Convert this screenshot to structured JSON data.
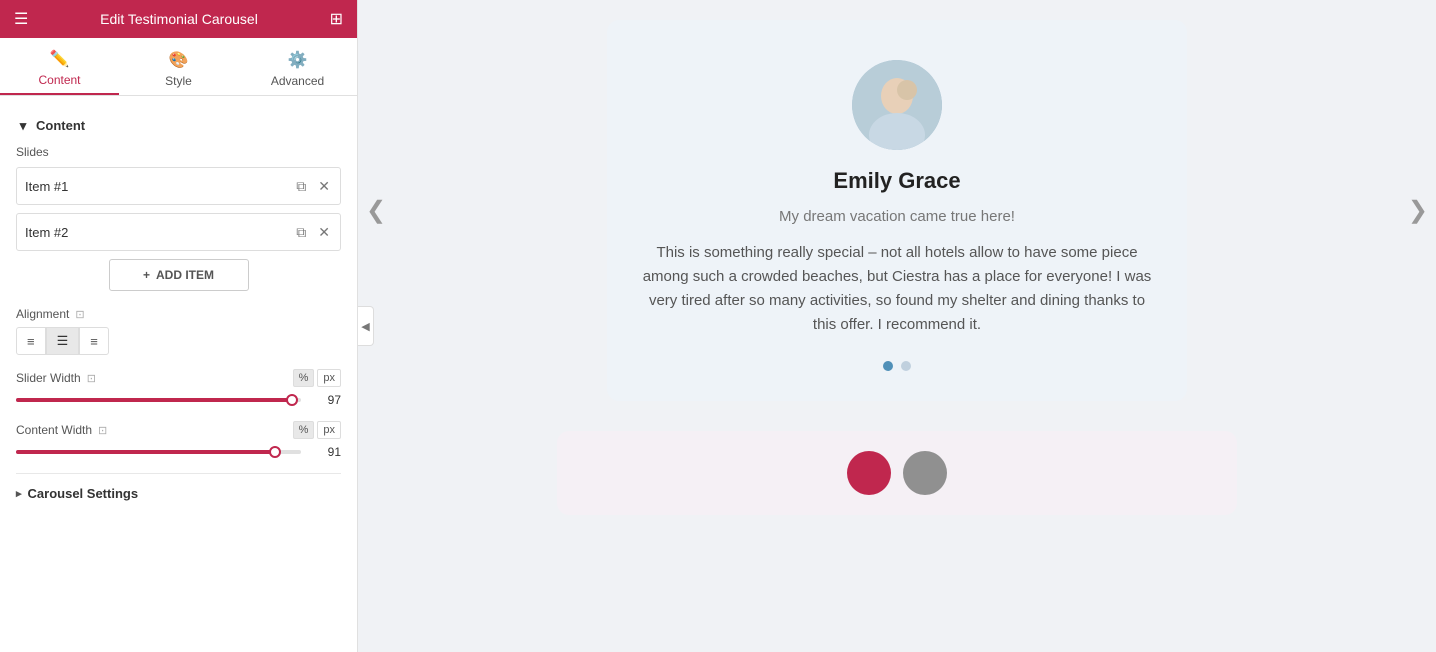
{
  "header": {
    "title": "Edit Testimonial Carousel",
    "menu_icon": "≡",
    "grid_icon": "⊞"
  },
  "tabs": [
    {
      "id": "content",
      "label": "Content",
      "icon": "✏️",
      "active": true
    },
    {
      "id": "style",
      "label": "Style",
      "icon": "🎨",
      "active": false
    },
    {
      "id": "advanced",
      "label": "Advanced",
      "icon": "⚙️",
      "active": false
    }
  ],
  "content_section": {
    "label": "Content",
    "slides_label": "Slides",
    "slides": [
      {
        "id": "item1",
        "label": "Item #1"
      },
      {
        "id": "item2",
        "label": "Item #2"
      }
    ],
    "add_item_label": "ADD ITEM",
    "alignment_label": "Alignment",
    "alignment_options": [
      "left",
      "center",
      "right"
    ],
    "active_alignment": "center",
    "slider_width_label": "Slider Width",
    "slider_width_value": "97",
    "slider_width_unit": "%",
    "slider_width_alt_unit": "px",
    "content_width_label": "Content Width",
    "content_width_value": "91",
    "content_width_unit": "%",
    "content_width_alt_unit": "px"
  },
  "carousel_settings": {
    "label": "Carousel Settings"
  },
  "testimonial": {
    "name": "Emily Grace",
    "subtitle": "My dream vacation came true here!",
    "body": "This is something really special – not all hotels allow to have some piece among such a crowded beaches, but Ciestra has a place for everyone! I was very tired after so many activities, so found my shelter and dining thanks to this offer. I recommend it.",
    "dots": [
      {
        "active": true
      },
      {
        "active": false
      }
    ]
  },
  "icons": {
    "chevron_left": "❮",
    "chevron_right": "❯",
    "collapse": "◀",
    "caret_down": "▾",
    "caret_right": "▸",
    "plus": "+",
    "copy": "⧉",
    "close": "✕",
    "info": "⊡"
  }
}
